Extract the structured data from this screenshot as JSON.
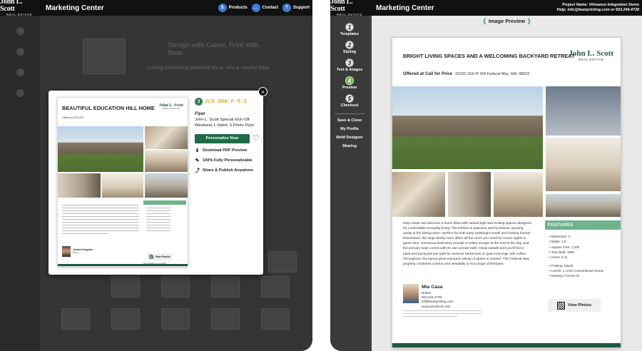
{
  "brand": {
    "logo_line1": "John L. Scott",
    "logo_line2": "REAL ESTATE"
  },
  "app_title": "Marketing Center",
  "top_nav": [
    {
      "icon": "dollar-icon",
      "glyph": "$",
      "label": "Products"
    },
    {
      "icon": "chat-icon",
      "glyph": "…",
      "label": "Contact"
    },
    {
      "icon": "question-icon",
      "glyph": "?",
      "label": "Support"
    }
  ],
  "left_background": {
    "headline": "Design with Canva. Print with Bear.",
    "subheadline": "Listing marketing powered by ai, mls & county data"
  },
  "modal": {
    "close_glyph": "×",
    "code_glyph": "3",
    "code": "JLS-SKW-F-5-2",
    "type": "Flyer",
    "name": "John L. Scott Special Kick-Off Weekend 1 Sided, 5 Photo Flyer",
    "cta": "Personalize Now",
    "heart_glyph": "♡",
    "actions": [
      {
        "icon": "download-icon",
        "glyph": "⬇",
        "label": "Download PDF Preview"
      },
      {
        "icon": "edit-icon",
        "glyph": "✎",
        "label": "100% Fully Personalizable"
      },
      {
        "icon": "share-icon",
        "glyph": "⤴",
        "label": "Share & Publish Anywhere"
      }
    ],
    "thumb": {
      "title": "BEAUTIFUL EDUCATION HILL HOME",
      "logo_line1": "John L. Scott",
      "logo_line2": "REAL ESTATE",
      "offer": "Offered at $750,000",
      "agent_name": "Jordan Kingston",
      "agent_title": "Broker",
      "view_photos": "View Photos",
      "url": "http://jlsdemo.com/1045"
    }
  },
  "right": {
    "project_line": "Project Name: Virtuance Integration Demo",
    "help_line": "Help: info@bearprinting.com or 503.244.4738",
    "steps": [
      {
        "num": "1",
        "label": "Templates",
        "active": false
      },
      {
        "num": "2",
        "label": "Styling",
        "active": false
      },
      {
        "num": "3",
        "label": "Text & Images",
        "active": false
      },
      {
        "num": "4",
        "label": "Preview",
        "active": true
      },
      {
        "num": "5",
        "label": "Checkout",
        "active": false
      }
    ],
    "side_links": [
      "Save & Close",
      "My Profile",
      "Motif Designer",
      "Sharing"
    ],
    "preview_title": "Image Preview",
    "flyer": {
      "title": "BRIGHT LIVING SPACES AND A WELCOMING BACKYARD RETREAT",
      "logo_line1": "John L. Scott",
      "logo_line2": "REAL ESTATE",
      "offer": "Offered at Call for Price",
      "address": "31626 11th Pl SW Federal Way, WA, 98023",
      "description": "Step inside and discover a home filled with natural light and inviting spaces designed for comfortable everyday living. The kitchen is spacious and functional, opening easily to the dining area—perfect for both easy weeknight meals and hosting friends. Downstairs, the large family room offers all the room you need for movie nights or game time. Generous bedrooms provide a restful escape at the end of the day, and the primary suite comes with its own private bath. Head outside and you'll find a patio and backyard just right for summer barbecues or quiet mornings with coffee. Throughout, the layout gives everyone plenty of space to unwind. This Federal Way property combines comfort and versatility to fit a range of lifestyles.",
      "features_header": "FEATURES",
      "features": [
        "Bedrooms: 3",
        "Baths: 1.6",
        "Square Feet: 1,200",
        "Year Built: 1980",
        "Acres: 0.11"
      ],
      "features2": [
        "Parking: Mixed",
        "Levels: 1 Level Conventional House",
        "Heating: Forced Air"
      ],
      "agent_name": "Mia Casa",
      "agent_title": "Broker",
      "agent_phone": "503.244.4738",
      "agent_email": "bill@bearprinting.com",
      "agent_site": "www.johnlscott.com",
      "view_photos": "View Photos"
    }
  }
}
